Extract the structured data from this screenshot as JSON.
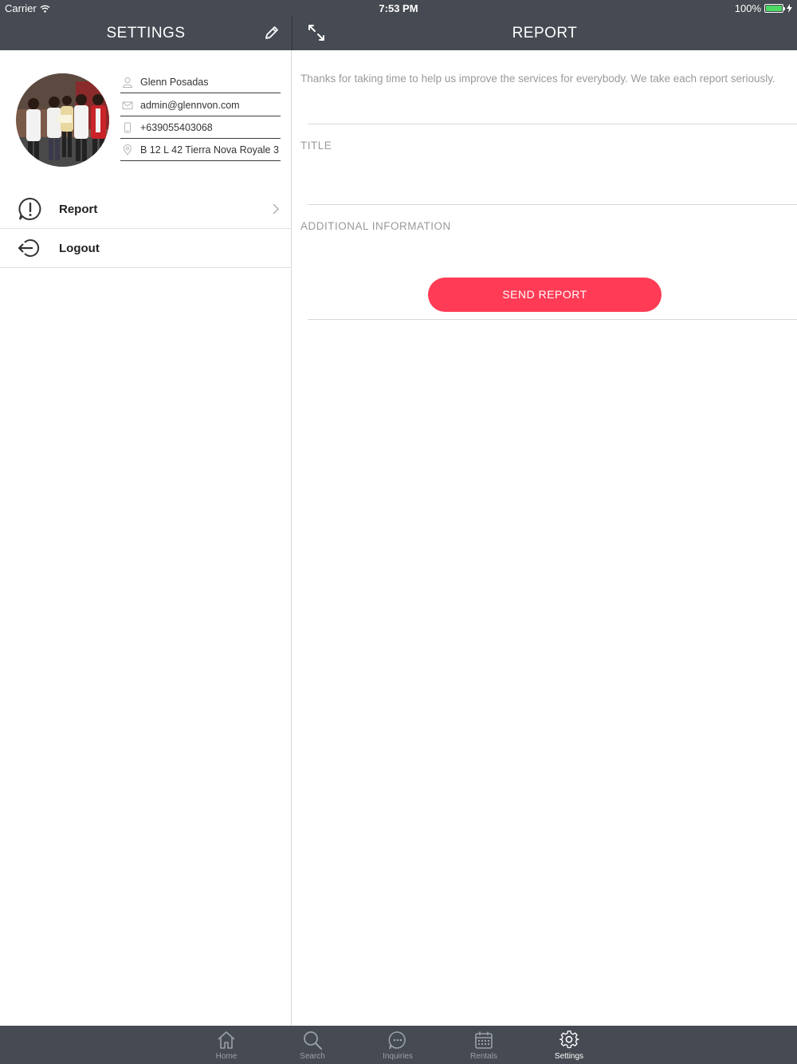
{
  "status": {
    "carrier": "Carrier",
    "time": "7:53 PM",
    "battery": "100%"
  },
  "settings": {
    "title": "SETTINGS",
    "profile": {
      "name": "Glenn Posadas",
      "email": "admin@glennvon.com",
      "phone": "+639055403068",
      "address": "B 12 L 42 Tierra Nova Royale 3"
    },
    "menu": [
      {
        "label": "Report",
        "icon": "exclamation-bubble-icon"
      },
      {
        "label": "Logout",
        "icon": "logout-icon"
      }
    ]
  },
  "report": {
    "title": "REPORT",
    "intro": "Thanks for taking time to help us improve the services for everybody. We take each report seriously.",
    "title_label": "TITLE",
    "additional_label": "ADDITIONAL INFORMATION",
    "send_label": "SEND REPORT",
    "accent_color": "#ff3b55"
  },
  "tabbar": {
    "tabs": [
      {
        "label": "Home",
        "icon": "home-icon"
      },
      {
        "label": "Search",
        "icon": "search-icon"
      },
      {
        "label": "Inquiries",
        "icon": "chat-icon"
      },
      {
        "label": "Rentals",
        "icon": "calendar-icon"
      },
      {
        "label": "Settings",
        "icon": "gear-icon",
        "active": true
      }
    ]
  },
  "colors": {
    "bar_background": "#464a52",
    "battery_fill": "#4cd964"
  }
}
